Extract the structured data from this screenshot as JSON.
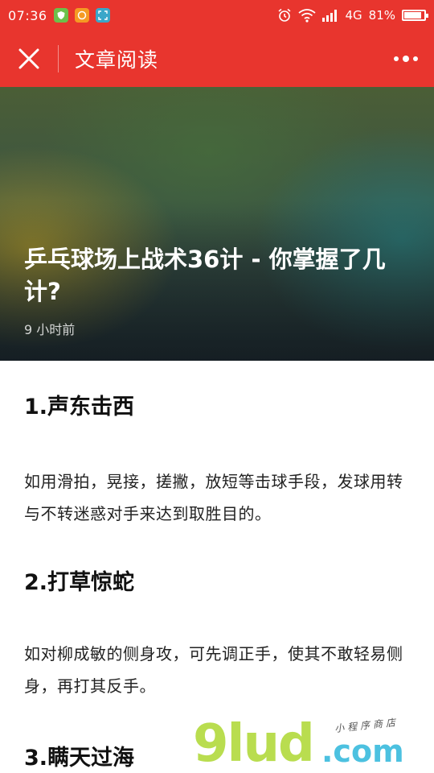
{
  "status_bar": {
    "time": "07:36",
    "network": "4G",
    "battery_text": "81%",
    "battery_level": 0.81,
    "icons": [
      "app-shield-icon",
      "app-orange-icon",
      "app-scan-icon",
      "alarm-icon",
      "wifi-icon",
      "signal-icon",
      "battery-icon"
    ]
  },
  "nav": {
    "title": "文章阅读",
    "close_icon": "close-icon",
    "more_icon": "more-icon"
  },
  "hero": {
    "title": "乒乓球场上战术36计 - 你掌握了几计?",
    "time": "9 小时前"
  },
  "article": {
    "sections": [
      {
        "title": "1.声东击西",
        "body": "如用滑拍，晃接，搓撇，放短等击球手段，发球用转与不转迷惑对手来达到取胜目的。"
      },
      {
        "title": "2.打草惊蛇",
        "body": "如对柳成敏的侧身攻，可先调正手，使其不敢轻易侧身，再打其反手。"
      },
      {
        "title": "3.瞒天过海",
        "body": ""
      }
    ]
  },
  "watermark": {
    "main": "9lud",
    "dotcom": ".com",
    "sub": "小程序商店"
  },
  "colors": {
    "brand": "#e8352e",
    "watermark_green": "#b9dd4f",
    "watermark_blue": "#4cc1e0"
  }
}
